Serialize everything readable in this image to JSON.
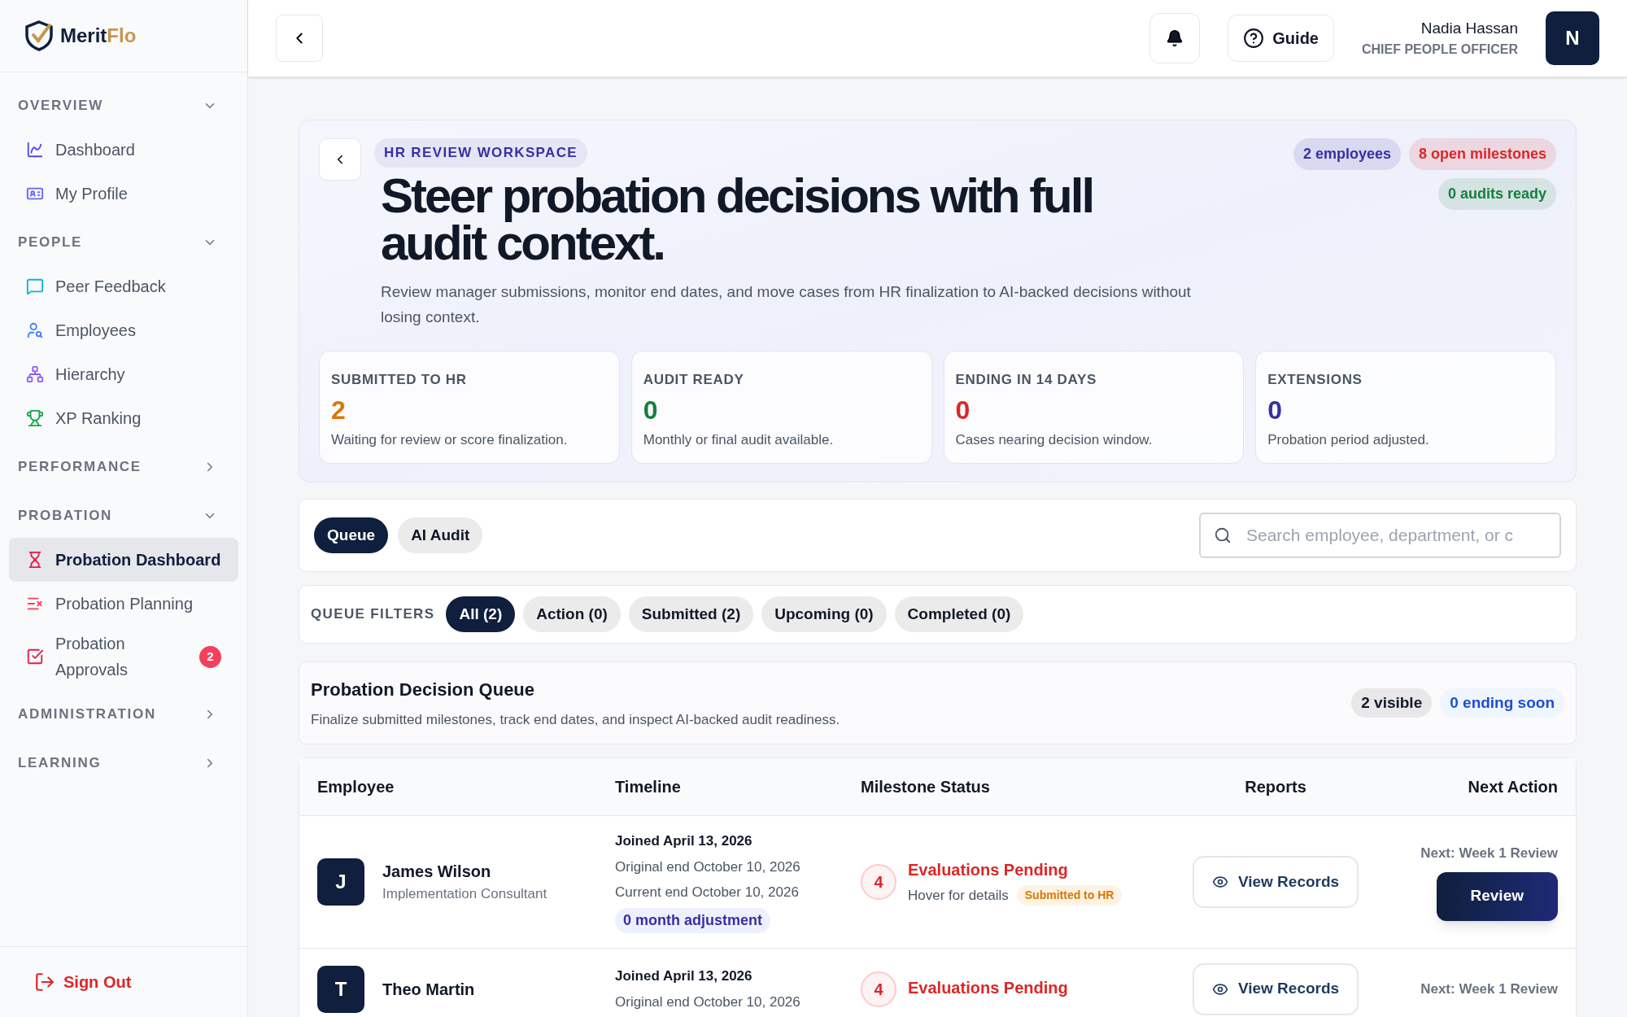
{
  "brand": {
    "name_main": "Merit",
    "name_accent": "Flo"
  },
  "sidebar": {
    "sections": [
      {
        "label": "OVERVIEW",
        "expanded": true,
        "items": [
          {
            "label": "Dashboard",
            "selected": false
          },
          {
            "label": "My Profile",
            "selected": false
          }
        ]
      },
      {
        "label": "PEOPLE",
        "expanded": true,
        "items": [
          {
            "label": "Peer Feedback",
            "selected": false
          },
          {
            "label": "Employees",
            "selected": false
          },
          {
            "label": "Hierarchy",
            "selected": false
          },
          {
            "label": "XP Ranking",
            "selected": false
          }
        ]
      },
      {
        "label": "PERFORMANCE",
        "expanded": false
      },
      {
        "label": "PROBATION",
        "expanded": true,
        "items": [
          {
            "label": "Probation Dashboard",
            "selected": true
          },
          {
            "label": "Probation Planning",
            "selected": false
          },
          {
            "label": "Probation Approvals",
            "selected": false,
            "count": "2"
          }
        ]
      },
      {
        "label": "ADMINISTRATION",
        "expanded": false
      },
      {
        "label": "LEARNING",
        "expanded": false
      }
    ],
    "sign_out": "Sign Out"
  },
  "header": {
    "guide": "Guide",
    "user_name": "Nadia Hassan",
    "user_role": "CHIEF PEOPLE OFFICER",
    "avatar": "N"
  },
  "hero": {
    "eyebrow": "HR REVIEW WORKSPACE",
    "title": "Steer probation decisions with full audit context.",
    "description": "Review manager submissions, monitor end dates, and move cases from HR finalization to AI-backed decisions without losing context.",
    "pills": [
      {
        "label": "2 employees",
        "color": "#3730a3"
      },
      {
        "label": "8 open milestones",
        "color": "#dc2626"
      },
      {
        "label": "0 audits ready",
        "color": "#15803d"
      }
    ],
    "stats": [
      {
        "label": "SUBMITTED TO HR",
        "value": "2",
        "note": "Waiting for review or score finalization.",
        "color": "#d97706"
      },
      {
        "label": "AUDIT READY",
        "value": "0",
        "note": "Monthly or final audit available.",
        "color": "#15803d"
      },
      {
        "label": "ENDING IN 14 DAYS",
        "value": "0",
        "note": "Cases nearing decision window.",
        "color": "#dc2626"
      },
      {
        "label": "EXTENSIONS",
        "value": "0",
        "note": "Probation period adjusted.",
        "color": "#3730a3"
      }
    ]
  },
  "view_tabs": [
    {
      "label": "Queue",
      "selected": true
    },
    {
      "label": "AI Audit",
      "selected": false
    }
  ],
  "search": {
    "placeholder": "Search employee, department, or c"
  },
  "filters": {
    "label": "QUEUE FILTERS",
    "items": [
      {
        "label": "All (2)",
        "selected": true
      },
      {
        "label": "Action (0)",
        "selected": false
      },
      {
        "label": "Submitted (2)",
        "selected": false
      },
      {
        "label": "Upcoming (0)",
        "selected": false
      },
      {
        "label": "Completed (0)",
        "selected": false
      }
    ]
  },
  "queue": {
    "title": "Probation Decision Queue",
    "subtitle": "Finalize submitted milestones, track end dates, and inspect AI-backed audit readiness.",
    "visible": "2 visible",
    "ending": "0 ending soon"
  },
  "table": {
    "columns": [
      "Employee",
      "Timeline",
      "Milestone Status",
      "Reports",
      "Next Action"
    ],
    "rows": [
      {
        "initial": "J",
        "name": "James Wilson",
        "role": "Implementation Consultant",
        "joined": "Joined April 13, 2026",
        "original_end": "Original end October 10, 2026",
        "current_end": "Current end October 10, 2026",
        "adjustment": "0 month adjustment",
        "pending_count": "4",
        "status": "Evaluations Pending",
        "hint": "Hover for details",
        "tag": "Submitted to HR",
        "reports": "View Records",
        "next": "Next: Week 1 Review",
        "action": "Review"
      },
      {
        "initial": "T",
        "name": "Theo Martin",
        "joined": "Joined April 13, 2026",
        "original_end": "Original end October 10, 2026",
        "pending_count": "4",
        "status": "Evaluations Pending",
        "reports": "View Records",
        "next": "Next: Week 1 Review"
      }
    ]
  }
}
